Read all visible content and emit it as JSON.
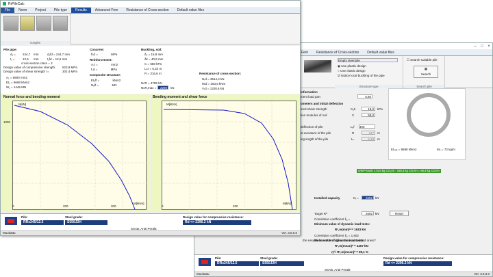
{
  "win1": {
    "title": "RrPileCalc",
    "menu": [
      "File",
      "Norm",
      "Project",
      "Pile type",
      "Results",
      "Advanced Fem",
      "Resistance of Cross-section",
      "Default value files"
    ],
    "ribbon_group": "Graphs",
    "pile_pipe": {
      "title": "Pile pipe:",
      "d1": "d₁ =",
      "d1v": "244,7",
      "d1u": "mm",
      "t1": "t₁ =",
      "t1v": "12,5",
      "t1u": "mm",
      "cs": "cross-section class =",
      "csv": "2",
      "dc": "Design value of compressive strength:",
      "dcv": "523,8",
      "dcu": "MPa",
      "dc2": "Design value of shear strength τ=",
      "dc2v": "302,4",
      "dc2u": "MPa",
      "A": "A₁ =",
      "Av": "6900",
      "Au": "mm2",
      "EI": "EI₁ =",
      "EIv": "9698",
      "EIu": "kNm2",
      "Ex": "d₁fd =",
      "Exv": "",
      "W": "W₁ =",
      "Wv": "1449",
      "Wu": "MN",
      "ds": "d₁fd =",
      "dsv": "244,7",
      "dsu": "mm",
      "ts": "t₁fd =",
      "tsv": "12,5",
      "tsu": "mm"
    },
    "concrete": {
      "title": "Concrete:",
      "fcd": "fᴄd =",
      "fcdu": "MPa",
      "rein": "Reinforcement:",
      "Ast": "Aₛt =",
      "Astu": "mm2",
      "fsd": "fₛd =",
      "fsdu": "MPa",
      "comp": "Composite structure:",
      "EIeff": "EIₑff =",
      "EIeffu": "kNm2",
      "Neff": "Nₑff =",
      "Neffu": "MN"
    },
    "buckling": {
      "title": "Buckling, soil:",
      "d0": "δ₀ =",
      "d0v": "15,8",
      "d0u": "mm",
      "dk": "δk =",
      "dkv": "40,9",
      "dku": "mm",
      "C": "C =",
      "Cv": "588",
      "Cu": "kPa",
      "Lcr": "Lᴄr =",
      "Lcrv": "6,33",
      "Lcru": "m",
      "R": "R =",
      "Rv": "316,6",
      "Ru": "m",
      "NcR": "NᴄR =",
      "NcRv": "4795",
      "NcRu": "kN",
      "NcRmax": "NᴄR,max =",
      "NcRmaxv": "2296",
      "NcRmaxu": "kN"
    },
    "roc": {
      "title": "Resistance of cross-section:",
      "N": "Nᵣd =",
      "Nv": "3614,4",
      "Nu": "kN",
      "M": "Mᵣd =",
      "Mv": "263,5",
      "Mu": "kNm",
      "V": "Vᵣd =",
      "Vv": "1328,6",
      "Vu": "kN"
    },
    "chart1": {
      "title": "Normal force and bending moment",
      "yunit": "N[kN]",
      "xunit": "M[kNm]",
      "ymax": "1000",
      "xticks": [
        "0",
        "200",
        "300"
      ],
      "yticks": [
        "1000",
        "0"
      ]
    },
    "chart2": {
      "title": "Bending moment and shear force",
      "yunit": "M[kNm]",
      "xunit": "M[kN]",
      "xticks": [
        "0",
        "200"
      ]
    },
    "footer": {
      "pile_label": "Pile:",
      "pile_value": "RRs245/12.5",
      "steel_label": "Steel grade:",
      "steel_value": "S550J2H",
      "design_label": "Design value for compressive resistance:",
      "design_value": "Rd <= 2296.2 kN",
      "company": "SSAB, Antti Perälä"
    },
    "status": {
      "left": "Muokattu",
      "right": "Ver. 3.5.0.0"
    }
  },
  "win2": {
    "menu": [
      "Fem",
      "Resistance of Cross-section",
      "Default value files"
    ],
    "structure": {
      "select": "Empty steel pile",
      "opt1": "Use plastic design",
      "opt2": "Use elastic design",
      "opt3": "Notice local buckling of the pipe",
      "label": "Structure type"
    },
    "search": {
      "check": "Search suitable pile",
      "btn": "Search",
      "label": "Search pile"
    },
    "info": {
      "l1": "information",
      "l2": "ment load part",
      "l2v": "0,80",
      "l3": "ometers and initial deflection",
      "l4": "ined shear strength",
      "cuk": "Cᵤk",
      "cukv": "18,0",
      "cuku": "kPa",
      "l5": "tion modulus of soil",
      "C": "C",
      "Cv": "58,0",
      "l6": "deflection of pile",
      "Luf": "Lᵤf",
      "Lufv": "400",
      "l7": "al curvature of the pile",
      "Rl": "R",
      "Rv": "317",
      "Ru": "m",
      "l8": "ing length of the pile",
      "Lk": "Lₖ",
      "Lkv": "6,33",
      "Lku": "m"
    },
    "props": {
      "EI": "EIₚᵢₗₑ =",
      "EIv": "9698 kNm2",
      "Mp": "Mₚ =",
      "Mpv": "72 kg/m"
    },
    "co2": "GWP-fossil: 174,6 kg CO₂/m - 169,3 kg CO₂/m = 86,4 kg CO₂/m",
    "results": {
      "inst": "Installed capacity",
      "Ni": "Nᵢ =",
      "Niv": "2692",
      "Niu": "kN",
      "target": "Target Rᵈ",
      "tv": "2692",
      "tu": "kN",
      "reset": "Reset",
      "cc": "Correlation coefficient ξ₅ =",
      "ccv": "1,379",
      "min": "Minimum value of dynamic load tests:",
      "rmin": "Rᶜ,m(min)ᵈ =",
      "rminv": "1933",
      "rminu": "kN",
      "cc2": "Correlation coefficient ξ₆ =",
      "cc2v": "1,502",
      "mean": "Mean value of dynamic load tests:",
      "rmean": "Rᶜ,m(mean)ᵈ =",
      "rmeanv": "4467",
      "rmeanu": "kN",
      "util": "ηᵈ / Rᶜ,m(mean)ᵈ =",
      "utilv": "89,1",
      "utilu": "%",
      "note": "the results from PDA higher than calculated ones?"
    },
    "footer": {
      "pile_label": "Pile:",
      "pile_value": "RRs245/12.5",
      "steel_label": "Steel grade:",
      "steel_value": "S550J2H",
      "design_label": "Design value for compressive resistance:",
      "design_value": "Rd <= 2296.2 kN",
      "company": "SSAB, Antti Perälä"
    },
    "status": {
      "left": "Muokattu",
      "right": "Ver. 3.5.0.0"
    }
  },
  "colors": {
    "accent": "#1e3d7c",
    "brand": "#2b5797",
    "curve": "#1515c8"
  }
}
